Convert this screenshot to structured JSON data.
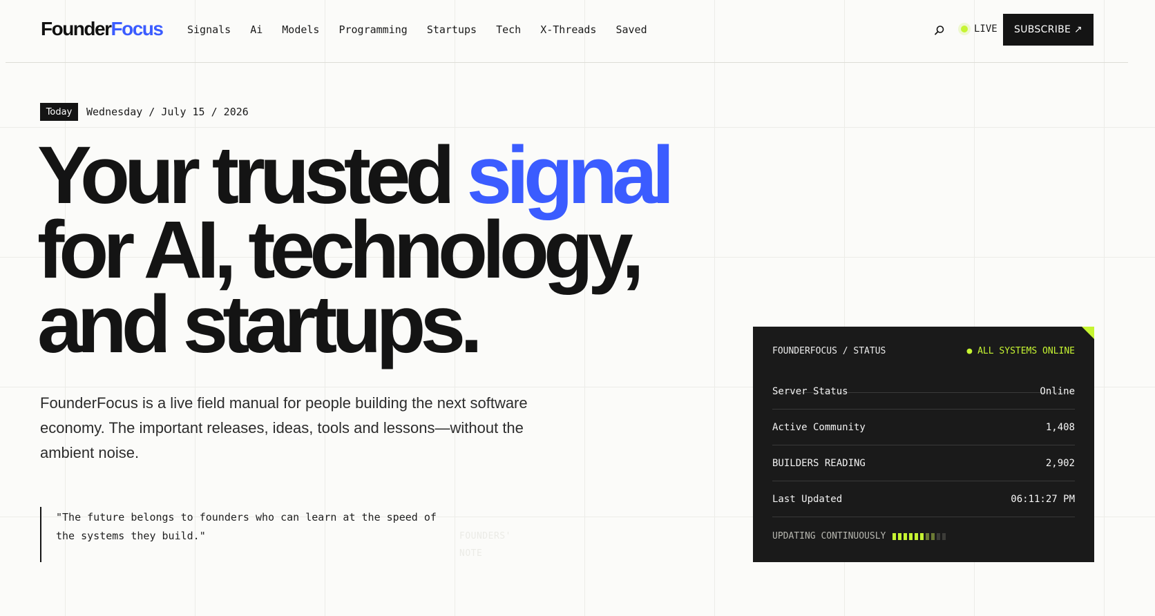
{
  "header": {
    "logo_part1": "Founder",
    "logo_part2": "Focus",
    "nav": [
      "Signals",
      "Ai",
      "Models",
      "Programming",
      "Startups",
      "Tech",
      "X-Threads",
      "Saved"
    ],
    "search_icon": "search-icon",
    "live_label": "LIVE",
    "subscribe_label": "SUBSCRIBE ↗"
  },
  "date": {
    "badge": "Today",
    "text": "Wednesday / July 15 / 2026"
  },
  "hero": {
    "line1_main": "Your trusted ",
    "line1_accent": "signal",
    "line2": "for AI, technology,",
    "line3": "and startups.",
    "description": "FounderFocus is a live field manual for people building the next software economy. The important releases, ideas, tools and lessons—without the ambient noise."
  },
  "quote": {
    "text": "\"The future belongs to founders who can learn at the speed of the systems they build.\"",
    "caption_line1": "FOUNDERS'",
    "caption_line2": "NOTE"
  },
  "status": {
    "title": "FOUNDERFOCUS / STATUS",
    "online": "● ALL SYSTEMS ONLINE",
    "rows": [
      {
        "label": "Server Status",
        "value": "Online"
      },
      {
        "label": "Active Community",
        "value": "1,408"
      },
      {
        "label": "BUILDERS READING",
        "value": "2,902"
      },
      {
        "label": "Last Updated",
        "value": "06:11:27 PM"
      }
    ],
    "footer": "UPDATING CONTINUOUSLY",
    "meter_level": 0.6
  },
  "colors": {
    "accent": "#3b5cff",
    "live": "#c6f432",
    "panel_bg": "#1a1a1a"
  }
}
